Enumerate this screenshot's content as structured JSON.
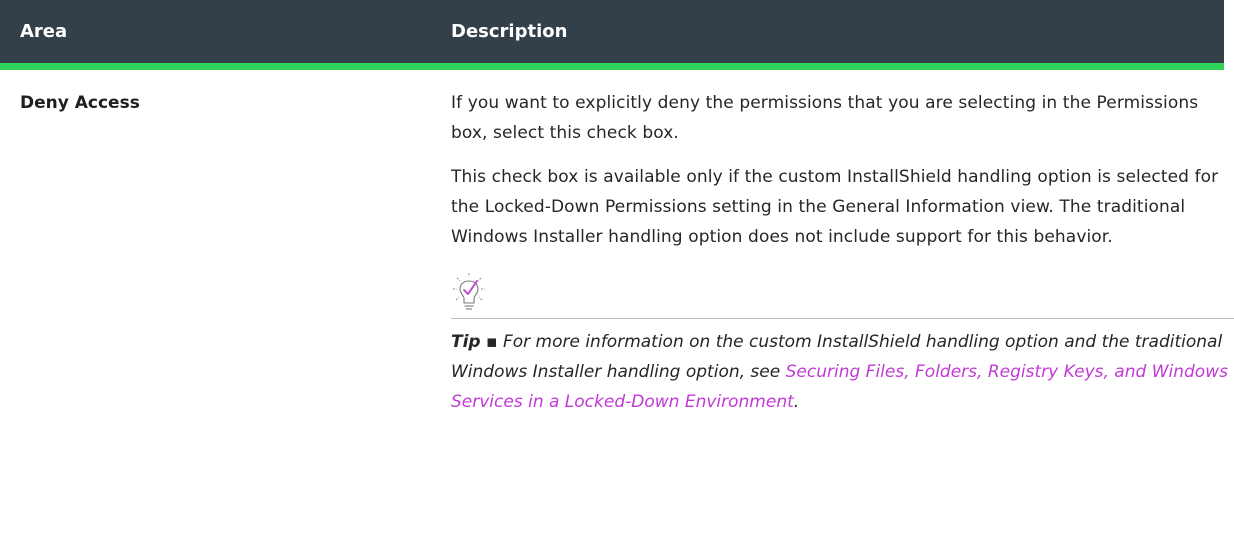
{
  "table": {
    "headers": {
      "area": "Area",
      "description": "Description"
    },
    "rows": [
      {
        "area": "Deny Access",
        "paragraphs": [
          "If you want to explicitly deny the permissions that you are selecting in the Permissions box, select this check box.",
          "This check box is available only if the custom InstallShield handling option is selected for the Locked-Down Permissions setting in the General Information view. The traditional Windows Installer handling option does not include support for this behavior."
        ],
        "tip": {
          "icon": "lightbulb-check-icon",
          "label": "Tip",
          "separator": " ▪ ",
          "text_before_link": "For more information on the custom InstallShield handling option and the traditional Windows Installer handling option, see ",
          "link_text": "Securing Files, Folders, Registry Keys, and Windows Services in a Locked-Down Environment",
          "text_after_link": "."
        }
      }
    ]
  },
  "colors": {
    "header_bg": "#344049",
    "header_accent": "#2fd35a",
    "link": "#c23ad6"
  }
}
